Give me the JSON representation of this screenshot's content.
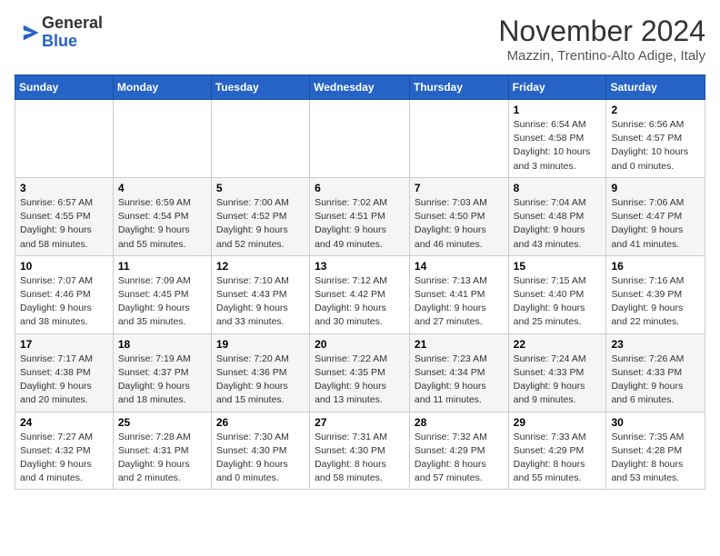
{
  "logo": {
    "text_general": "General",
    "text_blue": "Blue"
  },
  "title": "November 2024",
  "location": "Mazzin, Trentino-Alto Adige, Italy",
  "days_of_week": [
    "Sunday",
    "Monday",
    "Tuesday",
    "Wednesday",
    "Thursday",
    "Friday",
    "Saturday"
  ],
  "weeks": [
    [
      {
        "day": "",
        "info": ""
      },
      {
        "day": "",
        "info": ""
      },
      {
        "day": "",
        "info": ""
      },
      {
        "day": "",
        "info": ""
      },
      {
        "day": "",
        "info": ""
      },
      {
        "day": "1",
        "info": "Sunrise: 6:54 AM\nSunset: 4:58 PM\nDaylight: 10 hours and 3 minutes."
      },
      {
        "day": "2",
        "info": "Sunrise: 6:56 AM\nSunset: 4:57 PM\nDaylight: 10 hours and 0 minutes."
      }
    ],
    [
      {
        "day": "3",
        "info": "Sunrise: 6:57 AM\nSunset: 4:55 PM\nDaylight: 9 hours and 58 minutes."
      },
      {
        "day": "4",
        "info": "Sunrise: 6:59 AM\nSunset: 4:54 PM\nDaylight: 9 hours and 55 minutes."
      },
      {
        "day": "5",
        "info": "Sunrise: 7:00 AM\nSunset: 4:52 PM\nDaylight: 9 hours and 52 minutes."
      },
      {
        "day": "6",
        "info": "Sunrise: 7:02 AM\nSunset: 4:51 PM\nDaylight: 9 hours and 49 minutes."
      },
      {
        "day": "7",
        "info": "Sunrise: 7:03 AM\nSunset: 4:50 PM\nDaylight: 9 hours and 46 minutes."
      },
      {
        "day": "8",
        "info": "Sunrise: 7:04 AM\nSunset: 4:48 PM\nDaylight: 9 hours and 43 minutes."
      },
      {
        "day": "9",
        "info": "Sunrise: 7:06 AM\nSunset: 4:47 PM\nDaylight: 9 hours and 41 minutes."
      }
    ],
    [
      {
        "day": "10",
        "info": "Sunrise: 7:07 AM\nSunset: 4:46 PM\nDaylight: 9 hours and 38 minutes."
      },
      {
        "day": "11",
        "info": "Sunrise: 7:09 AM\nSunset: 4:45 PM\nDaylight: 9 hours and 35 minutes."
      },
      {
        "day": "12",
        "info": "Sunrise: 7:10 AM\nSunset: 4:43 PM\nDaylight: 9 hours and 33 minutes."
      },
      {
        "day": "13",
        "info": "Sunrise: 7:12 AM\nSunset: 4:42 PM\nDaylight: 9 hours and 30 minutes."
      },
      {
        "day": "14",
        "info": "Sunrise: 7:13 AM\nSunset: 4:41 PM\nDaylight: 9 hours and 27 minutes."
      },
      {
        "day": "15",
        "info": "Sunrise: 7:15 AM\nSunset: 4:40 PM\nDaylight: 9 hours and 25 minutes."
      },
      {
        "day": "16",
        "info": "Sunrise: 7:16 AM\nSunset: 4:39 PM\nDaylight: 9 hours and 22 minutes."
      }
    ],
    [
      {
        "day": "17",
        "info": "Sunrise: 7:17 AM\nSunset: 4:38 PM\nDaylight: 9 hours and 20 minutes."
      },
      {
        "day": "18",
        "info": "Sunrise: 7:19 AM\nSunset: 4:37 PM\nDaylight: 9 hours and 18 minutes."
      },
      {
        "day": "19",
        "info": "Sunrise: 7:20 AM\nSunset: 4:36 PM\nDaylight: 9 hours and 15 minutes."
      },
      {
        "day": "20",
        "info": "Sunrise: 7:22 AM\nSunset: 4:35 PM\nDaylight: 9 hours and 13 minutes."
      },
      {
        "day": "21",
        "info": "Sunrise: 7:23 AM\nSunset: 4:34 PM\nDaylight: 9 hours and 11 minutes."
      },
      {
        "day": "22",
        "info": "Sunrise: 7:24 AM\nSunset: 4:33 PM\nDaylight: 9 hours and 9 minutes."
      },
      {
        "day": "23",
        "info": "Sunrise: 7:26 AM\nSunset: 4:33 PM\nDaylight: 9 hours and 6 minutes."
      }
    ],
    [
      {
        "day": "24",
        "info": "Sunrise: 7:27 AM\nSunset: 4:32 PM\nDaylight: 9 hours and 4 minutes."
      },
      {
        "day": "25",
        "info": "Sunrise: 7:28 AM\nSunset: 4:31 PM\nDaylight: 9 hours and 2 minutes."
      },
      {
        "day": "26",
        "info": "Sunrise: 7:30 AM\nSunset: 4:30 PM\nDaylight: 9 hours and 0 minutes."
      },
      {
        "day": "27",
        "info": "Sunrise: 7:31 AM\nSunset: 4:30 PM\nDaylight: 8 hours and 58 minutes."
      },
      {
        "day": "28",
        "info": "Sunrise: 7:32 AM\nSunset: 4:29 PM\nDaylight: 8 hours and 57 minutes."
      },
      {
        "day": "29",
        "info": "Sunrise: 7:33 AM\nSunset: 4:29 PM\nDaylight: 8 hours and 55 minutes."
      },
      {
        "day": "30",
        "info": "Sunrise: 7:35 AM\nSunset: 4:28 PM\nDaylight: 8 hours and 53 minutes."
      }
    ]
  ]
}
